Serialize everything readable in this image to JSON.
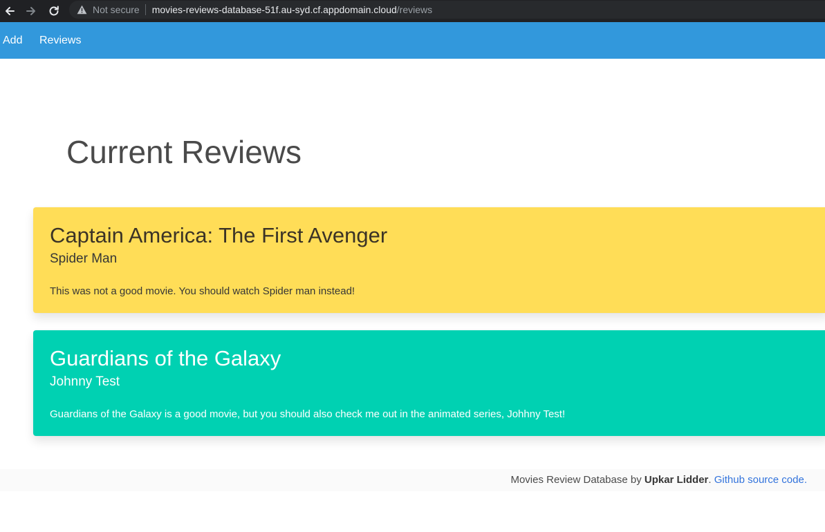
{
  "browser": {
    "security_label": "Not secure",
    "url_host": "movies-reviews-database-51f.au-syd.cf.appdomain.cloud",
    "url_path": "/reviews",
    "icons": [
      "back-arrow-icon",
      "forward-arrow-icon",
      "reload-icon",
      "warning-icon"
    ]
  },
  "navbar": {
    "links": [
      {
        "label": "Add"
      },
      {
        "label": "Reviews"
      }
    ],
    "color": "#3298dc"
  },
  "main": {
    "title": "Current Reviews",
    "reviews": [
      {
        "movie": "Captain America: The First Avenger",
        "reviewer": "Spider Man",
        "text": "This was not a good movie. You should watch Spider man instead!",
        "color": "#ffdd57"
      },
      {
        "movie": "Guardians of the Galaxy",
        "reviewer": "Johnny Test",
        "text": "Guardians of the Galaxy is a good movie, but you should also check me out in the animated series, Johhny Test!",
        "color": "#00d1b2"
      }
    ]
  },
  "footer": {
    "prefix": "Movies Review Database by ",
    "author": "Upkar Lidder",
    "separator": ". ",
    "link_label": "Github source code."
  }
}
